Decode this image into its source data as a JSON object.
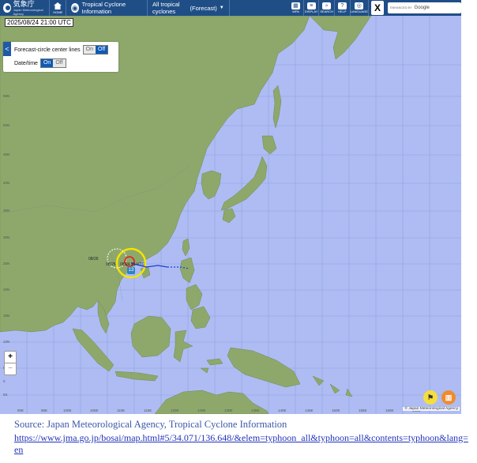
{
  "header": {
    "logo_text": "気象庁",
    "logo_sub": "Japan Meteorological Agency",
    "home_label": "HOME",
    "tc_title": "Tropical Cyclone Information",
    "select_label": "All tropical cyclones",
    "select_value": "(Forecast)",
    "buttons": [
      {
        "label": "WPA"
      },
      {
        "label": "DISPLAY"
      },
      {
        "label": "SEARCH"
      },
      {
        "label": "HELP"
      },
      {
        "label": "LANGUAGE"
      }
    ],
    "x_label": "X",
    "search_prefix": "ENHANCED BY",
    "search_brand": "Google"
  },
  "map": {
    "timestamp": "2025/08/24 21:00 UTC",
    "panel": {
      "collapse": "<",
      "forecast_lines_label": "Forecast-circle center lines",
      "datetime_label": "Date/time",
      "on": "On",
      "off": "Off"
    },
    "lat_labels": [
      "60N",
      "55N",
      "50N",
      "45N",
      "40N",
      "35N",
      "30N",
      "25N",
      "20N",
      "15N",
      "10N",
      "5N",
      "0",
      "5S"
    ],
    "lon_labels": [
      "90E",
      "95E",
      "100E",
      "105E",
      "110E",
      "115E",
      "120E",
      "125E",
      "130E",
      "135E",
      "140E",
      "145E",
      "150E",
      "155E",
      "160E",
      "165E",
      "170E"
    ],
    "track_labels": [
      "08/26",
      "08/25",
      "08/24 21 UTC"
    ],
    "badge": "13",
    "attribution": "© Japan Meteorological Agency",
    "zoom_in": "+",
    "zoom_out": "−",
    "colors": {
      "sea": "#aebcf3",
      "land": "#8ea86c",
      "header": "#1f4e87"
    }
  },
  "caption": {
    "source": "Source: Japan Meteorological  Agency, Tropical Cyclone Information",
    "url": "https://www.jma.go.jp/bosai/map.html#5/34.071/136.648/&elem=typhoon_all&typhoon=all&contents=typhoon&lang=en"
  }
}
